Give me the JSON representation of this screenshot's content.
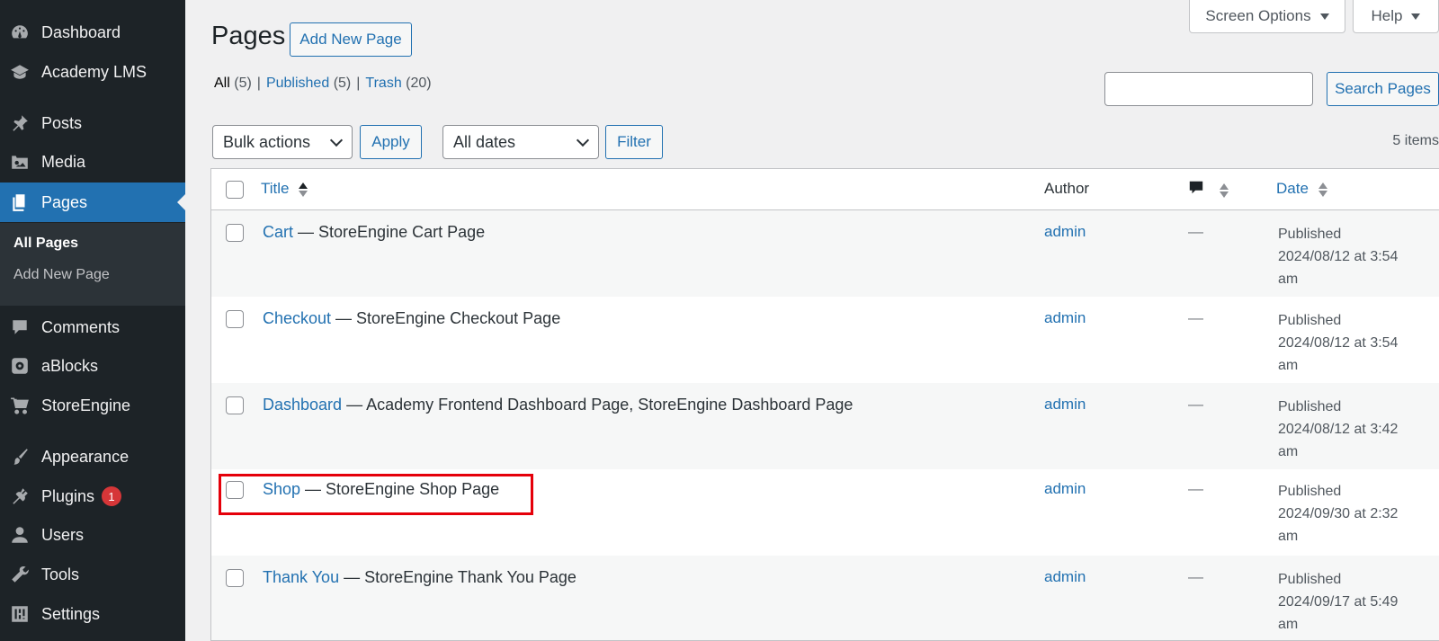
{
  "sidebar": {
    "items": [
      {
        "label": "Dashboard",
        "icon": "dashboard-icon"
      },
      {
        "label": "Academy LMS",
        "icon": "graduation-cap-icon"
      },
      {
        "label": "Posts",
        "icon": "pin-icon"
      },
      {
        "label": "Media",
        "icon": "media-icon"
      },
      {
        "label": "Pages",
        "icon": "pages-icon"
      },
      {
        "label": "Comments",
        "icon": "comment-icon"
      },
      {
        "label": "aBlocks",
        "icon": "ablocks-icon"
      },
      {
        "label": "StoreEngine",
        "icon": "cart-icon"
      },
      {
        "label": "Appearance",
        "icon": "brush-icon"
      },
      {
        "label": "Plugins",
        "icon": "plugin-icon",
        "badge": "1"
      },
      {
        "label": "Users",
        "icon": "user-icon"
      },
      {
        "label": "Tools",
        "icon": "wrench-icon"
      },
      {
        "label": "Settings",
        "icon": "settings-icon"
      }
    ],
    "submenu": [
      "All Pages",
      "Add New Page"
    ]
  },
  "header": {
    "title": "Pages",
    "add_new": "Add New Page",
    "screen_options": "Screen Options",
    "help": "Help"
  },
  "filters": {
    "all": "All",
    "all_count": "(5)",
    "published": "Published",
    "published_count": "(5)",
    "trash": "Trash",
    "trash_count": "(20)",
    "sep": "|"
  },
  "search": {
    "value": "",
    "button": "Search Pages"
  },
  "toolbar": {
    "bulk_actions": "Bulk actions",
    "apply": "Apply",
    "all_dates": "All dates",
    "filter": "Filter",
    "items_count": "5 items"
  },
  "table": {
    "columns": {
      "title": "Title",
      "author": "Author",
      "date": "Date"
    },
    "rows": [
      {
        "title": "Cart",
        "suffix": " — StoreEngine Cart Page",
        "author": "admin",
        "comments": "—",
        "status": "Published",
        "date": "2024/08/12 at 3:54",
        "ampm": "am"
      },
      {
        "title": "Checkout",
        "suffix": " — StoreEngine Checkout Page",
        "author": "admin",
        "comments": "—",
        "status": "Published",
        "date": "2024/08/12 at 3:54",
        "ampm": "am"
      },
      {
        "title": "Dashboard",
        "suffix": " — Academy Frontend Dashboard Page, StoreEngine Dashboard Page",
        "author": "admin",
        "comments": "—",
        "status": "Published",
        "date": "2024/08/12 at 3:42",
        "ampm": "am"
      },
      {
        "title": "Shop",
        "suffix": " — StoreEngine Shop Page",
        "author": "admin",
        "comments": "—",
        "status": "Published",
        "date": "2024/09/30 at 2:32",
        "ampm": "am"
      },
      {
        "title": "Thank You",
        "suffix": " — StoreEngine Thank You Page",
        "author": "admin",
        "comments": "—",
        "status": "Published",
        "date": "2024/09/17 at 5:49",
        "ampm": "am"
      }
    ]
  },
  "colors": {
    "accent": "#2271b1",
    "sidebar_bg": "#1d2327",
    "highlight": "#e5000a",
    "badge": "#d63638"
  }
}
